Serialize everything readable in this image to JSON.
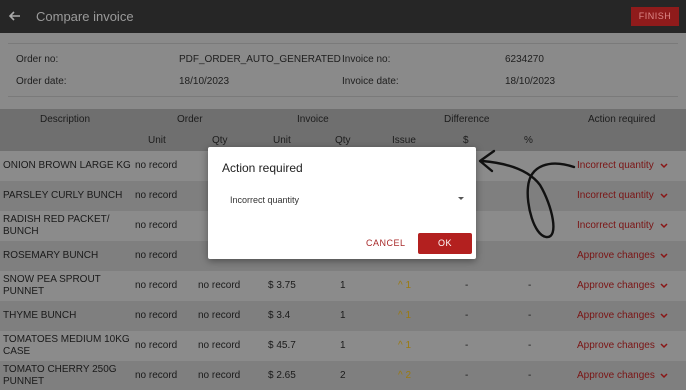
{
  "header": {
    "title": "Compare invoice",
    "finish_label": "FINISH"
  },
  "info": {
    "order_no_label": "Order no:",
    "order_no": "PDF_ORDER_AUTO_GENERATED",
    "invoice_no_label": "Invoice no:",
    "invoice_no": "6234270",
    "order_date_label": "Order date:",
    "order_date": "18/10/2023",
    "invoice_date_label": "Invoice date:",
    "invoice_date": "18/10/2023"
  },
  "columns": {
    "description": "Description",
    "order": "Order",
    "invoice": "Invoice",
    "difference": "Difference",
    "action": "Action required",
    "unit": "Unit",
    "qty": "Qty",
    "inv_unit": "Unit",
    "inv_qty": "Qty",
    "issue": "Issue",
    "dollar": "$",
    "percent": "%"
  },
  "rows": [
    {
      "desc": "ONION BROWN LARGE KG",
      "unit": "no record",
      "qty": "",
      "inv_unit": "",
      "inv_qty": "",
      "issue": "",
      "dollar": "",
      "pct": "",
      "action": "Incorrect quantity"
    },
    {
      "desc": "PARSLEY CURLY BUNCH",
      "unit": "no record",
      "qty": "",
      "inv_unit": "",
      "inv_qty": "",
      "issue": "",
      "dollar": "",
      "pct": "",
      "action": "Incorrect quantity"
    },
    {
      "desc": "RADISH RED PACKET/ BUNCH",
      "unit": "no record",
      "qty": "",
      "inv_unit": "",
      "inv_qty": "",
      "issue": "",
      "dollar": "",
      "pct": "",
      "action": "Incorrect quantity"
    },
    {
      "desc": "ROSEMARY BUNCH",
      "unit": "no record",
      "qty": "",
      "inv_unit": "",
      "inv_qty": "",
      "issue": "",
      "dollar": "",
      "pct": "",
      "action": "Approve changes"
    },
    {
      "desc": "SNOW PEA SPROUT PUNNET",
      "unit": "no record",
      "qty": "no record",
      "inv_unit": "$ 3.75",
      "inv_qty": "1",
      "issue": "^ 1",
      "dollar": "-",
      "pct": "-",
      "action": "Approve changes"
    },
    {
      "desc": "THYME BUNCH",
      "unit": "no record",
      "qty": "no record",
      "inv_unit": "$ 3.4",
      "inv_qty": "1",
      "issue": "^ 1",
      "dollar": "-",
      "pct": "-",
      "action": "Approve changes"
    },
    {
      "desc": "TOMATOES MEDIUM 10KG CASE",
      "unit": "no record",
      "qty": "no record",
      "inv_unit": "$ 45.7",
      "inv_qty": "1",
      "issue": "^ 1",
      "dollar": "-",
      "pct": "-",
      "action": "Approve changes"
    },
    {
      "desc": "TOMATO CHERRY 250G PUNNET",
      "unit": "no record",
      "qty": "no record",
      "inv_unit": "$ 2.65",
      "inv_qty": "2",
      "issue": "^ 2",
      "dollar": "-",
      "pct": "-",
      "action": "Approve changes"
    }
  ],
  "dialog": {
    "title": "Action required",
    "selected": "Incorrect quantity",
    "cancel_label": "CANCEL",
    "ok_label": "OK"
  },
  "colors": {
    "accent": "#b3201f",
    "topbar": "#262626",
    "issue": "#9a7a10"
  },
  "icons": {
    "back": "arrow-left-icon",
    "chevron": "chevron-down-icon",
    "caret": "dropdown-caret-icon"
  }
}
